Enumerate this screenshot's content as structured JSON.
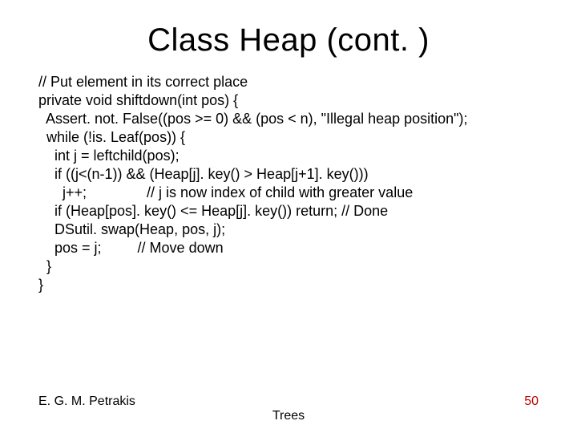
{
  "title": "Class Heap (cont. )",
  "code": "// Put element in its correct place\nprivate void shiftdown(int pos) {\n  Assert. not. False((pos >= 0) && (pos < n), \"Illegal heap position\");\n  while (!is. Leaf(pos)) {\n    int j = leftchild(pos);\n    if ((j<(n-1)) && (Heap[j]. key() > Heap[j+1]. key()))\n      j++;               // j is now index of child with greater value\n    if (Heap[pos]. key() <= Heap[j]. key()) return; // Done\n    DSutil. swap(Heap, pos, j);\n    pos = j;         // Move down\n  }\n}",
  "footer": {
    "author": "E. G. M. Petrakis",
    "topic": "Trees",
    "page": "50"
  }
}
